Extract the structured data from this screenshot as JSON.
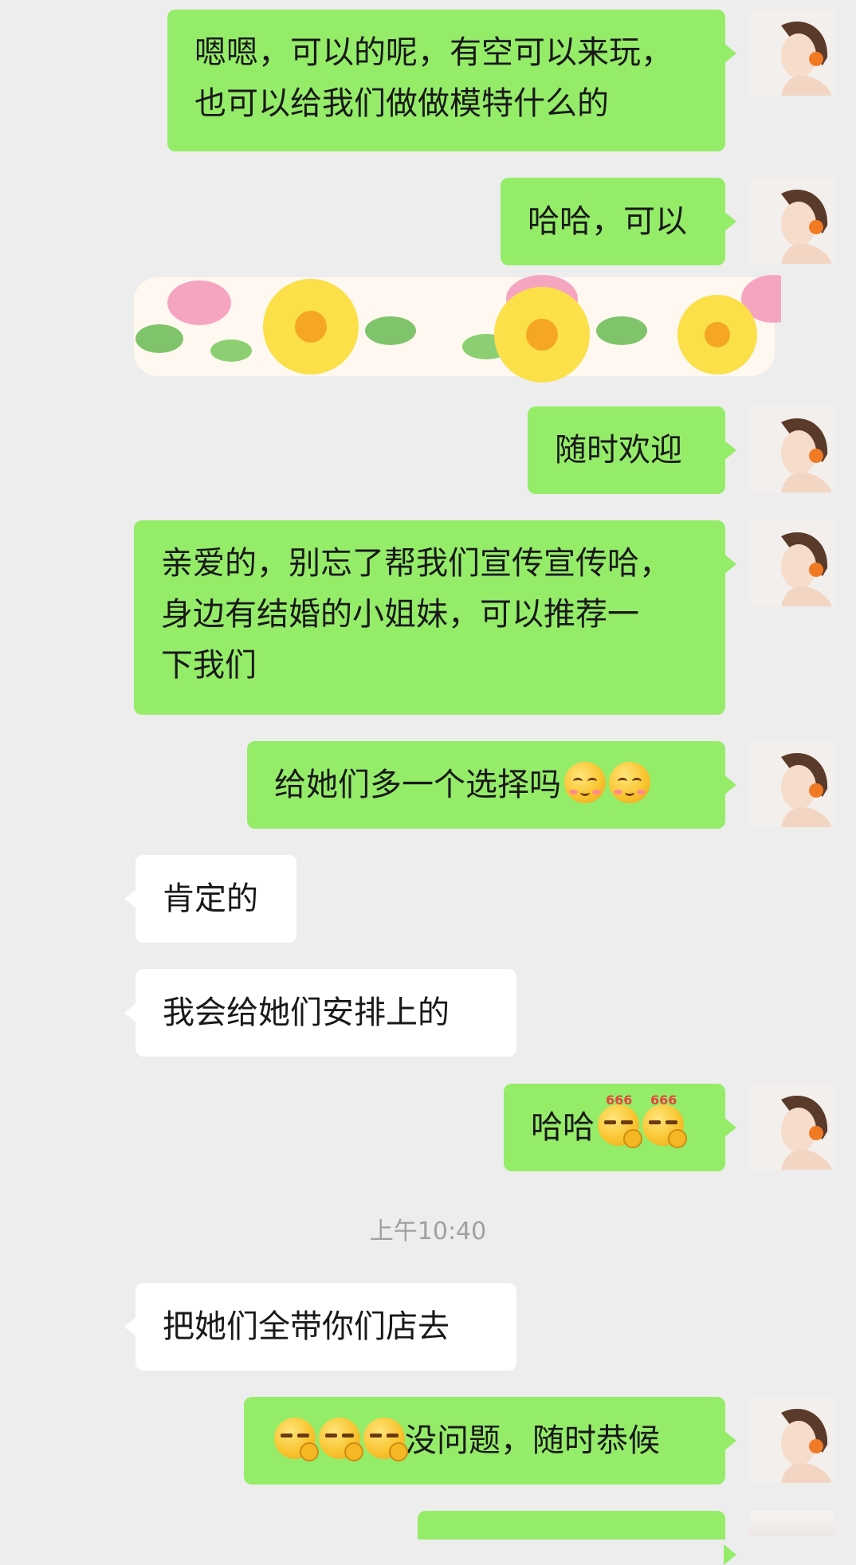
{
  "messages": [
    {
      "from": "me",
      "lines": [
        "嗯嗯，可以的呢，有空可以来玩，",
        "也可以给我们做做模特什么的"
      ]
    },
    {
      "from": "me",
      "text": "哈哈，可以"
    },
    {
      "from": "me",
      "text": "随时欢迎"
    },
    {
      "from": "me",
      "lines": [
        "亲爱的，别忘了帮我们宣传宣传哈，",
        "身边有结婚的小姐妹，可以推荐一",
        "下我们"
      ]
    },
    {
      "from": "me",
      "text": "给她们多一个选择吗"
    },
    {
      "from": "other",
      "text": "肯定的"
    },
    {
      "from": "other",
      "text": "我会给她们安排上的"
    },
    {
      "from": "me",
      "text": "哈哈"
    },
    {
      "from": "other",
      "text": "把她们全带你们店去"
    },
    {
      "from": "me",
      "text": "没问题，随时恭候"
    }
  ],
  "timestamp": "上午10:40",
  "sticker_label": "花朵贴图",
  "emoji_numbers": {
    "six": "666"
  },
  "colors": {
    "me_bubble": "#95ec69",
    "other_bubble": "#ffffff",
    "background": "#ededed"
  }
}
